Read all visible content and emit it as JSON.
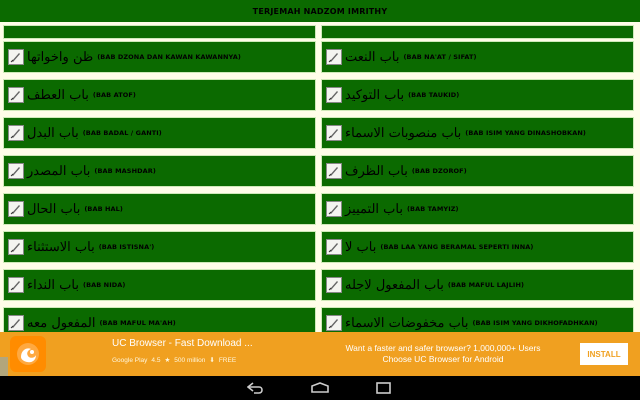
{
  "app": {
    "title": "TERJEMAH NADZOM IMRITHY"
  },
  "left_items": [
    {
      "arabic": "",
      "label": ""
    },
    {
      "arabic": "ظن واخواتها",
      "label": "(BAB DZONA DAN KAWAN KAWANNYA)"
    },
    {
      "arabic": "باب العطف",
      "label": "(BAB ATOF)"
    },
    {
      "arabic": "باب البدل",
      "label": "(BAB BADAL / GANTI)"
    },
    {
      "arabic": "باب المصدر",
      "label": "(BAB MASHDAR)"
    },
    {
      "arabic": "باب الحال",
      "label": "(BAB HAL)"
    },
    {
      "arabic": "باب الاستثناء",
      "label": "(BAB ISTISNA')"
    },
    {
      "arabic": "باب النداء",
      "label": "(BAB NIDA)"
    },
    {
      "arabic": "المفعول معه",
      "label": "(BAB MAFUL MA'AH)"
    }
  ],
  "right_items": [
    {
      "arabic": "",
      "label": ""
    },
    {
      "arabic": "باب النعت",
      "label": "(BAB NA'AT / SIFAT)"
    },
    {
      "arabic": "باب التوكيد",
      "label": "(BAB TAUKID)"
    },
    {
      "arabic": "باب منصوبات الاسماء",
      "label": "(BAB ISIM YANG DINASHOBKAN)"
    },
    {
      "arabic": "باب الظرف",
      "label": "(BAB DZOROF)"
    },
    {
      "arabic": "باب التمييز",
      "label": "(BAB TAMYIZ)"
    },
    {
      "arabic": "باب لا",
      "label": "(BAB LAA YANG BERAMAL SEPERTI INNA)"
    },
    {
      "arabic": "باب المفعول لاجله",
      "label": "(BAB MAFUL LAJLIH)"
    },
    {
      "arabic": "باب مخفوضات الاسماء",
      "label": "(BAB ISIM YANG DIKHOFADHKAN)"
    }
  ],
  "ad": {
    "title": "UC Browser - Fast Download ...",
    "store": "Google Play",
    "rating": "4.5",
    "downloads": "500 million",
    "price": "FREE",
    "message": "Want a faster and safer browser? 1,000,000+ Users Choose UC Browser for Android",
    "install_label": "INSTALL"
  },
  "colors": {
    "cell_green": "#0b6a00",
    "background": "#fffde8",
    "ad_orange": "#f0a020"
  },
  "icons": {
    "item_thumb": "quill-scroll-icon",
    "nav_back": "back-icon",
    "nav_home": "home-icon",
    "nav_recent": "recent-apps-icon"
  }
}
